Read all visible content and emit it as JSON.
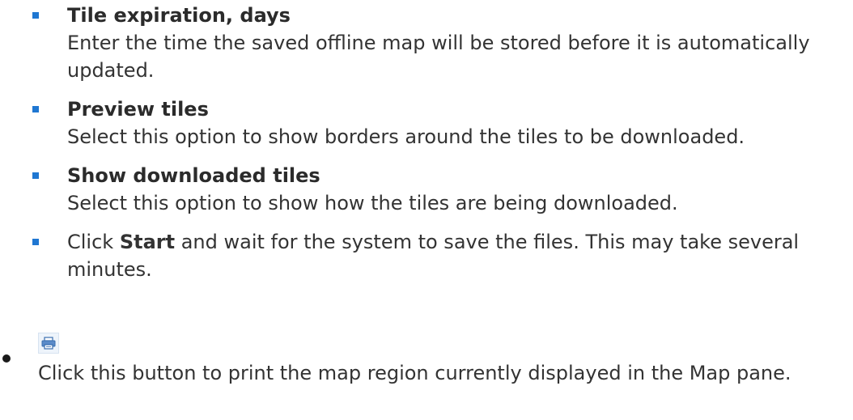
{
  "settings": [
    {
      "term": "Tile expiration, days",
      "description": "Enter the time the saved offline map will be stored before it is automatically updated."
    },
    {
      "term": "Preview tiles",
      "description": "Select this option to show borders around the tiles to be downloaded."
    },
    {
      "term": "Show downloaded tiles",
      "description": "Select this option to show how the tiles are being downloaded."
    }
  ],
  "start_step": {
    "prefix": "Click ",
    "button_name": "Start",
    "suffix": " and wait for the system to save the files. This may take several minutes."
  },
  "print_item": {
    "icon": "printer-icon",
    "description": "Click this button to print the map region currently displayed in the Map pane."
  },
  "colors": {
    "bullet": "#1f77d2",
    "text": "#333333",
    "icon_accent": "#3a6fb0"
  }
}
